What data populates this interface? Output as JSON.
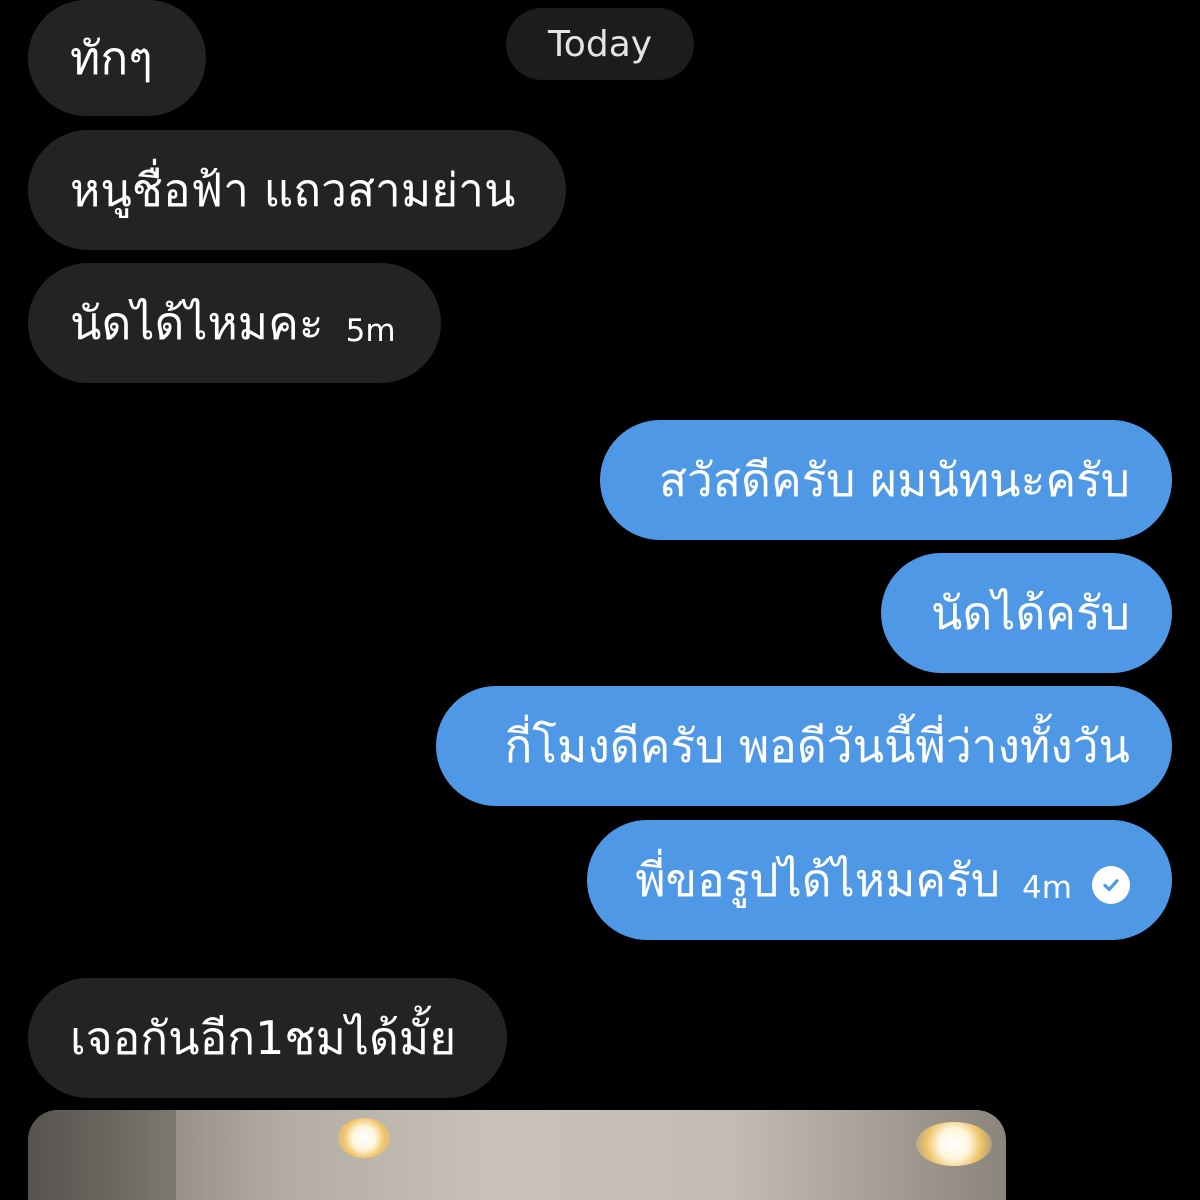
{
  "date_separator": "Today",
  "messages": [
    {
      "text": "ทักๆ"
    },
    {
      "text": "หนูชื่อฟ้า แถวสามย่าน"
    },
    {
      "text": "นัดได้ไหมคะ",
      "time": "5m"
    },
    {
      "text": "สวัสดีครับ ผมนัทนะครับ"
    },
    {
      "text": "นัดได้ครับ"
    },
    {
      "text": "กี่โมงดีครับ พอดีวันนี้พี่ว่างทั้งวัน"
    },
    {
      "text": "พี่ขอรูปได้ไหมครับ",
      "time": "4m",
      "status_icon": "read-check-icon"
    },
    {
      "text": "เจอกันอีก1ชมได้มั้ย"
    }
  ],
  "colors": {
    "background": "#000000",
    "incoming_bubble": "#232326",
    "outgoing_bubble": "#4e98e6",
    "date_pill": "#1c1c1e",
    "text": "#ffffff"
  },
  "attachment": {
    "type": "photo",
    "icon": "image-attachment"
  }
}
